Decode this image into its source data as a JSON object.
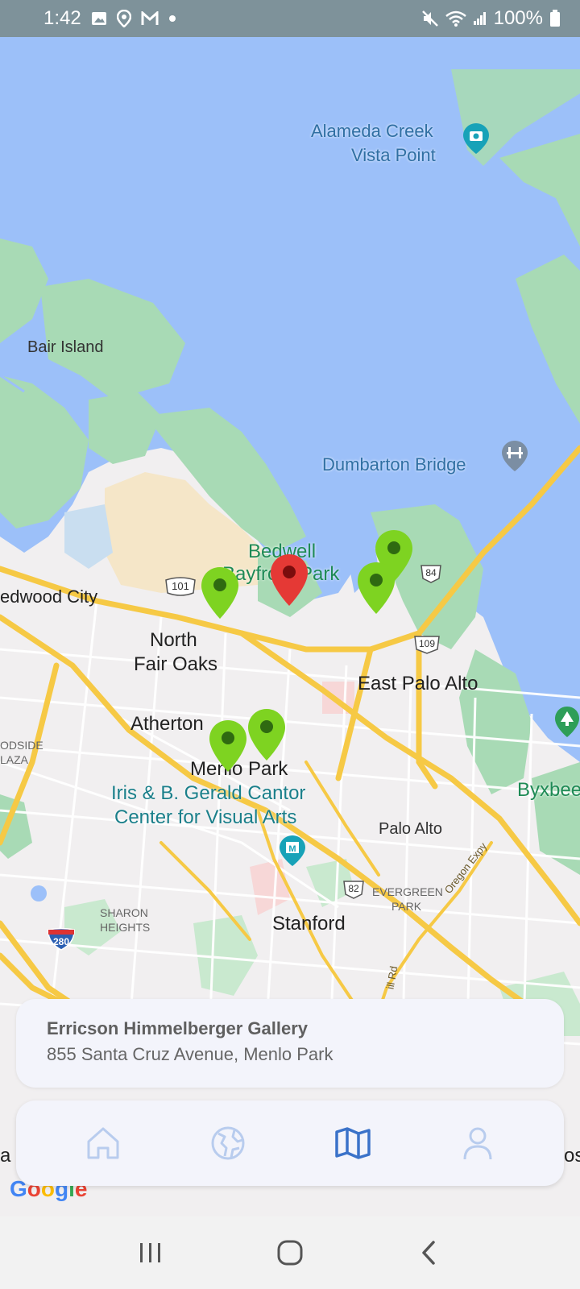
{
  "status_bar": {
    "time": "1:42",
    "battery": "100%",
    "icons": [
      "gallery-icon",
      "location-icon",
      "gmail-icon",
      "dot-icon",
      "mute-icon",
      "wifi-icon",
      "signal-icon",
      "battery-icon"
    ]
  },
  "map": {
    "labels": {
      "alameda_creek": "Alameda Creek",
      "vista_point": "Vista Point",
      "bair_island": "Bair Island",
      "dumbarton_bridge": "Dumbarton Bridge",
      "bedwell": "Bedwell",
      "bayfront_park": "Bayfront Park",
      "redwood_city": "edwood City",
      "north": "North",
      "fair_oaks": "Fair Oaks",
      "east_palo_alto": "East Palo Alto",
      "atherton": "Atherton",
      "woodside_line1": "ODSIDE",
      "woodside_line2": "LAZA",
      "menlo_park": "Menlo Park",
      "cantor_line1": "Iris & B. Gerald Cantor",
      "cantor_line2": "Center for Visual Arts",
      "byxbee": "Byxbee",
      "palo_alto": "Palo Alto",
      "oregon_expy": "Oregon Expy",
      "evergreen_line1": "EVERGREEN",
      "evergreen_line2": "PARK",
      "sharon_line1": "SHARON",
      "sharon_line2": "HEIGHTS",
      "stanford": "Stanford",
      "road_rd": "ill Rd",
      "edge_a": "a",
      "edge_os": "os"
    },
    "shields": {
      "us101": "101",
      "ca84": "84",
      "ca109": "109",
      "ca82": "82",
      "i280": "280"
    },
    "pins": [
      {
        "color": "#e53935",
        "selected": true
      },
      {
        "color": "#7ed321",
        "selected": false
      },
      {
        "color": "#7ed321",
        "selected": false
      },
      {
        "color": "#7ed321",
        "selected": false
      },
      {
        "color": "#7ed321",
        "selected": false
      },
      {
        "color": "#7ed321",
        "selected": false
      }
    ],
    "attribution": "Google"
  },
  "info_card": {
    "title": "Erricson Himmelberger Gallery",
    "address": "855 Santa Cruz Avenue, Menlo Park"
  },
  "bottom_nav": {
    "items": [
      {
        "icon": "home-icon",
        "active": false
      },
      {
        "icon": "globe-icon",
        "active": false
      },
      {
        "icon": "map-icon",
        "active": true
      },
      {
        "icon": "person-icon",
        "active": false
      }
    ],
    "active_color": "#3a72c9",
    "inactive_color": "#b8ccee"
  },
  "colors": {
    "water": "#9cc0f9",
    "park": "#a8dab5",
    "land": "#f1eff0",
    "sand": "#f5e6c8",
    "highway": "#f6c945"
  }
}
